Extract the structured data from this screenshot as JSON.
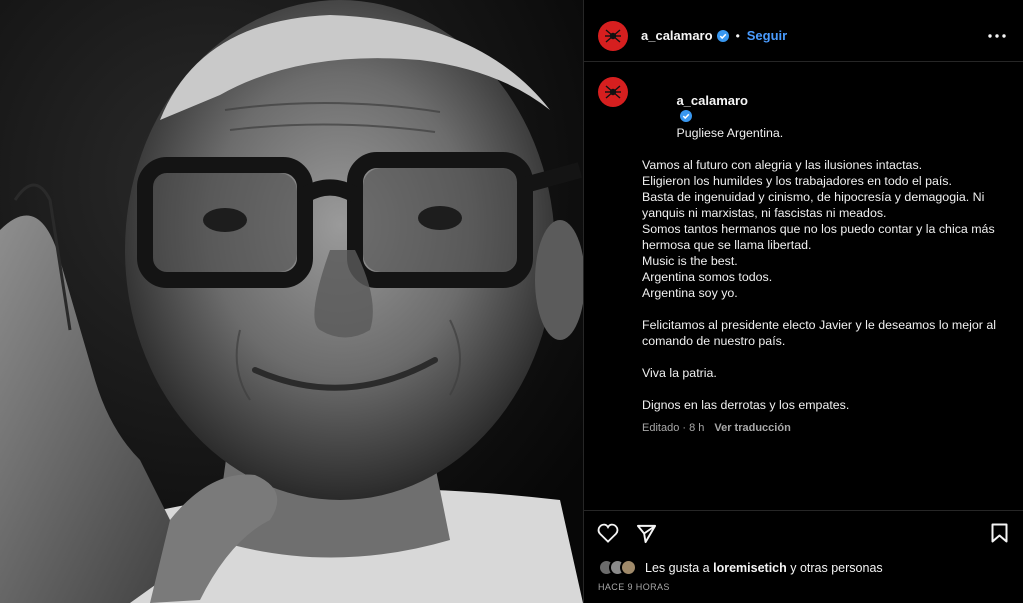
{
  "post": {
    "username": "a_calamaro",
    "follow_label": "Seguir",
    "separator": "•",
    "caption": {
      "first_line": "Pugliese Argentina.",
      "lines": [
        "Vamos al futuro con alegria y las ilusiones intactas.",
        "Eligieron los humildes y los trabajadores en todo el país.",
        "Basta de ingenuidad y cinismo, de hipocresía y demagogia. Ni",
        "yanquis ni marxistas, ni fascistas ni meados.",
        "Somos tantos hermanos que no los puedo contar y la chica más",
        "hermosa que se llama libertad.",
        "Music is the best.",
        "Argentina somos todos.",
        "Argentina soy yo.",
        "",
        "Felicitamos al presidente electo Javier y le deseamos lo mejor al",
        "comando de nuestro país.",
        "",
        "Viva la patria.",
        "",
        "Dignos en las derrotas y los empates."
      ]
    },
    "meta": {
      "edited": "Editado · 8 h",
      "translate": "Ver traducción"
    },
    "likes": {
      "prefix": "Les gusta a",
      "user": "loremisetich",
      "suffix": "y otras personas"
    },
    "timestamp": "HACE 9 HORAS"
  },
  "icons": {
    "avatar": "spider-logo-icon",
    "verified": "verified-badge-icon",
    "more": "more-options-icon",
    "like": "heart-icon",
    "share": "send-icon",
    "save": "bookmark-icon"
  },
  "colors": {
    "background": "#000000",
    "accent": "#4a9cff",
    "verified": "#3897f0",
    "avatar_red": "#d61f1f",
    "muted": "#a8a8a8",
    "divider": "#262626"
  }
}
